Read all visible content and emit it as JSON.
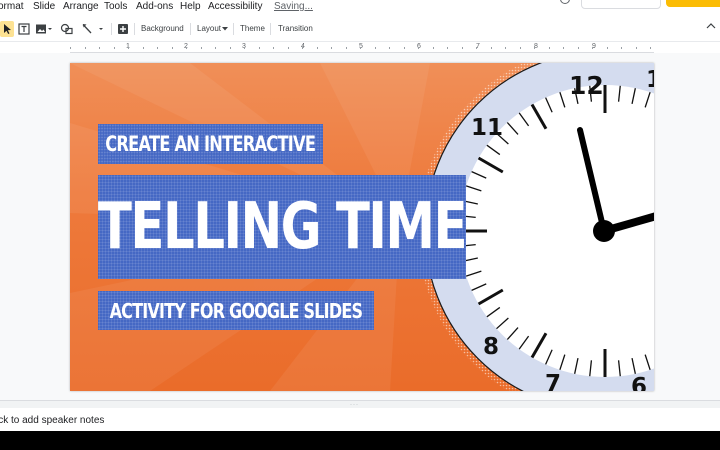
{
  "menu": {
    "items": [
      "ormat",
      "Slide",
      "Arrange",
      "Tools",
      "Add-ons",
      "Help",
      "Accessibility"
    ],
    "status": "Saving..."
  },
  "toolbar": {
    "background_label": "Background",
    "layout_label": "Layout",
    "theme_label": "Theme",
    "transition_label": "Transition"
  },
  "ruler": {
    "numbers": [
      "1",
      "2",
      "3",
      "4",
      "5",
      "6",
      "7",
      "8",
      "9"
    ]
  },
  "slide": {
    "line1": "Create an Interactive",
    "line2": "Telling Time",
    "line3": "Activity for Google Slides",
    "clock_numbers": [
      "12",
      "11",
      "1",
      "8",
      "7",
      "6"
    ],
    "colors": {
      "background": "#ee7a3c",
      "title_box": "#4568c4",
      "clock_rim": "#d4dcef",
      "clock_face": "#ffffff",
      "hands": "#000000"
    }
  },
  "notes": {
    "placeholder": "ick to add speaker notes"
  },
  "icons": [
    "select-arrow-icon",
    "text-box-icon",
    "image-icon",
    "shape-icon",
    "line-icon",
    "new-slide-plus-icon"
  ]
}
